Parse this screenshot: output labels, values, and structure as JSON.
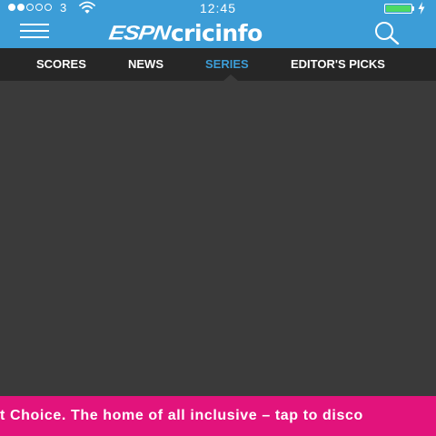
{
  "status_bar": {
    "carrier": "3",
    "time": "12:45",
    "signal_bars_filled": 2,
    "signal_bars_total": 5,
    "battery_level": 1.0,
    "battery_color": "#4cd964"
  },
  "header": {
    "logo_espn": "ESPN",
    "logo_cricinfo": "cricinfo",
    "menu_icon": "hamburger-menu-icon",
    "search_icon": "search-icon",
    "background_color": "#3c9dd7"
  },
  "nav": {
    "tabs": [
      {
        "label": "SCORES",
        "active": false
      },
      {
        "label": "NEWS",
        "active": false
      },
      {
        "label": "SERIES",
        "active": true
      },
      {
        "label": "EDITOR'S PICKS",
        "active": false
      }
    ],
    "active_color": "#3c9dd7",
    "background_color": "#262626"
  },
  "ad": {
    "text": "t Choice. The home of all inclusive – tap to disco",
    "background_color": "#e2137c"
  }
}
